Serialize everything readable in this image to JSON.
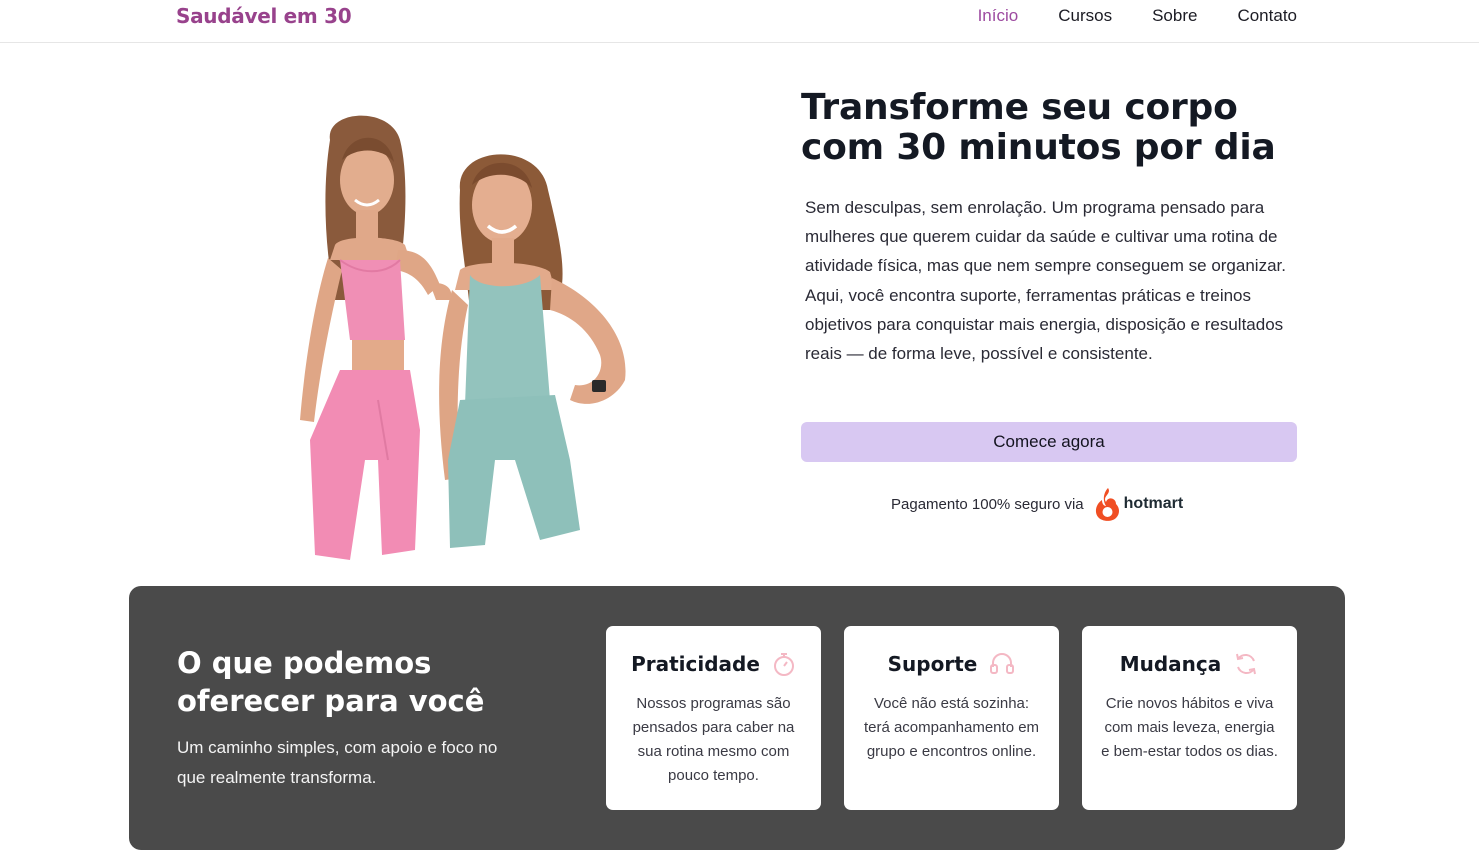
{
  "header": {
    "brand": "Saudável em 30",
    "nav": [
      {
        "label": "Início",
        "active": true
      },
      {
        "label": "Cursos",
        "active": false
      },
      {
        "label": "Sobre",
        "active": false
      },
      {
        "label": "Contato",
        "active": false
      }
    ]
  },
  "hero": {
    "image": "two smiling women in sportswear, one in pink and one in teal",
    "title": "Transforme seu corpo com 30 minutos por dia",
    "paragraph_1": "Sem desculpas, sem enrolação. Um programa pensado para mulheres que querem cuidar da saúde e cultivar uma rotina de atividade física, mas que nem sempre conseguem se organizar.",
    "paragraph_2": "Aqui, você encontra suporte, ferramentas práticas e treinos objetivos para conquistar mais energia, disposição e resultados reais — de forma leve, possível e consistente.",
    "cta_label": "Comece agora",
    "secure_text": "Pagamento 100% seguro via",
    "payment_brand": "hotmart"
  },
  "offer": {
    "title": "O que podemos oferecer para você",
    "subtitle": "Um caminho simples, com apoio e foco no que realmente transforma.",
    "cards": [
      {
        "title": "Praticidade",
        "icon": "stopwatch-icon",
        "text": "Nossos programas são pensados para caber na sua rotina mesmo com pouco tempo."
      },
      {
        "title": "Suporte",
        "icon": "headset-icon",
        "text": "Você não está sozinha: terá acompanhamento em grupo e encontros online."
      },
      {
        "title": "Mudança",
        "icon": "refresh-icon",
        "text": "Crie novos hábitos e viva com mais leveza, energia e bem-estar todos os dias."
      }
    ]
  },
  "colors": {
    "brand": "#98428c",
    "nav_active": "#9d4aa0",
    "cta_bg": "#d8c8f2",
    "panel_bg": "#4a4a4a",
    "icon_pink": "#f4b8c4",
    "hotmart_flame": "#f04e23"
  }
}
